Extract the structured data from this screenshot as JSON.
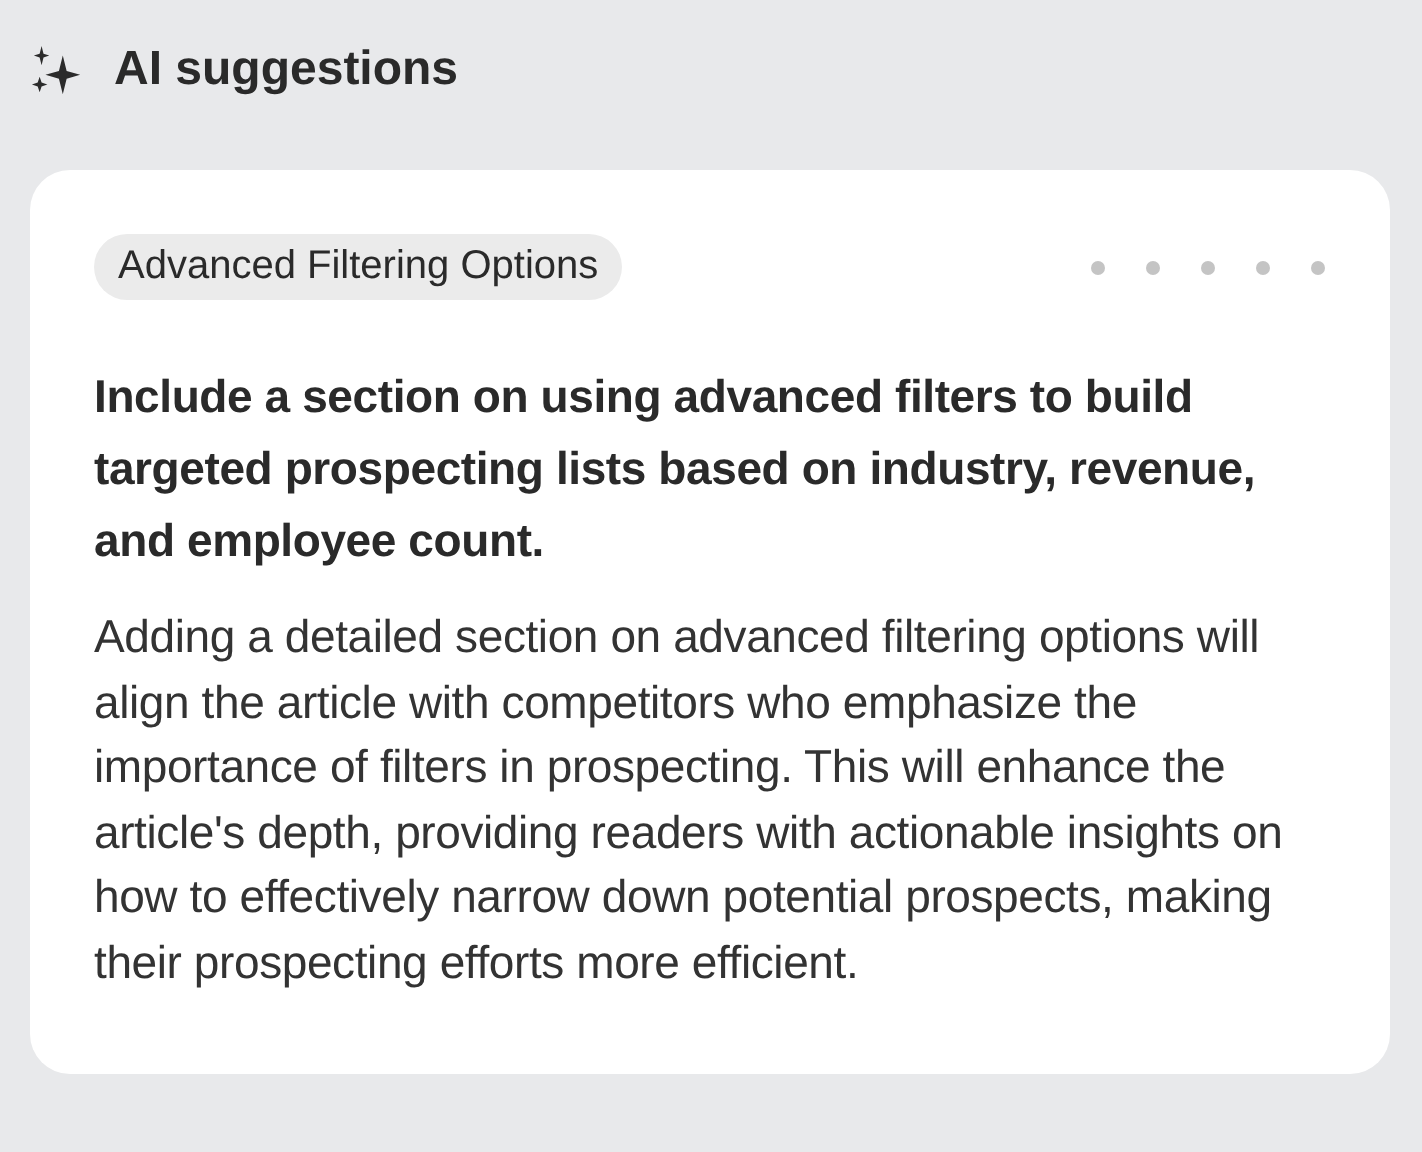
{
  "header": {
    "title": "AI suggestions"
  },
  "suggestion": {
    "tag": "Advanced Filtering Options",
    "heading": "Include a section on using advanced filters to build targeted prospecting lists based on industry, revenue, and employee count.",
    "body": "Adding a detailed section on advanced filtering options will align the article with competitors who emphasize the importance of filters in prospecting. This will enhance the article's depth, providing readers with actionable insights on how to effectively narrow down potential prospects, making their prospecting efforts more efficient."
  }
}
